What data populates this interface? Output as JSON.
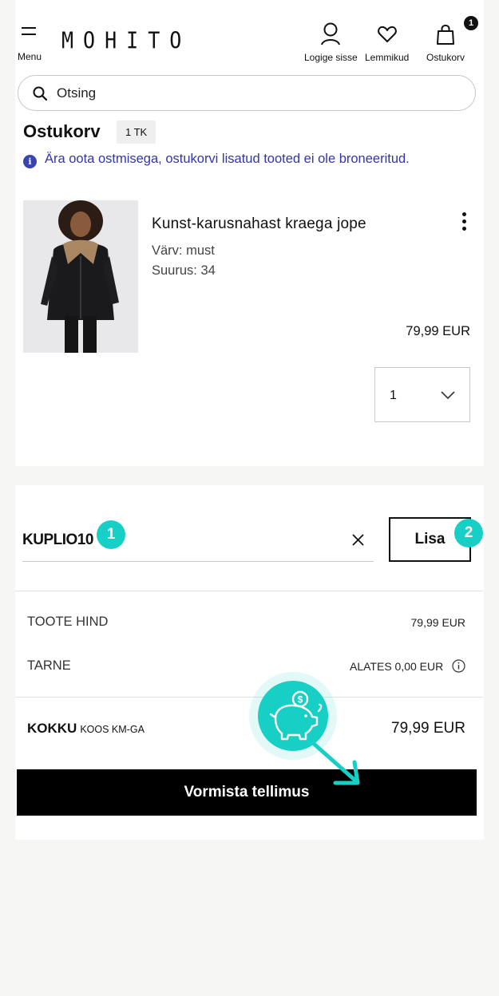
{
  "header": {
    "menu_label": "Menu",
    "logo": "MOHITO",
    "login_label": "Logige sisse",
    "favorites_label": "Lemmikud",
    "cart_label": "Ostukorv",
    "cart_badge": "1"
  },
  "search": {
    "placeholder": "Otsing"
  },
  "cart": {
    "title": "Ostukorv",
    "count": "1 TK",
    "notice": "Ära oota ostmisega, ostukorvi lisatud tooted ei ole broneeritud."
  },
  "product": {
    "name": "Kunst-karusnahast kraega jope",
    "color": "Värv: must",
    "size": "Suurus: 34",
    "price": "79,99 EUR",
    "quantity": "1"
  },
  "coupon": {
    "value": "KUPLIO10",
    "apply_label": "Lisa",
    "step_1": "1",
    "step_2": "2"
  },
  "summary": {
    "product_price_label": "TOOTE HIND",
    "product_price_value": "79,99 EUR",
    "shipping_label": "TARNE",
    "shipping_value": "ALATES 0,00 EUR",
    "total_label": "KOKKU",
    "total_sub": "KOOS KM-GA",
    "total_value": "79,99 EUR"
  },
  "checkout_label": "Vormista tellimus",
  "colors": {
    "accent": "#17cfc5",
    "info": "#3336a8",
    "button": "#000000"
  }
}
